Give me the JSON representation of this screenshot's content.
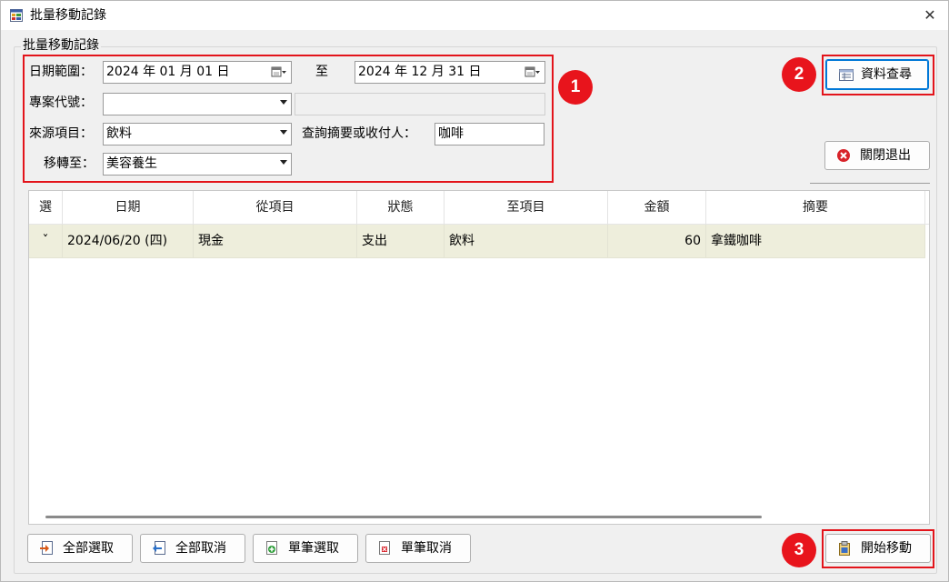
{
  "window": {
    "title": "批量移動記錄",
    "close_glyph": "✕"
  },
  "group": {
    "label": "批量移動記錄"
  },
  "filters": {
    "date_range_label": "日期範圍：",
    "date_from": "2024 年 01 月 01 日",
    "to_label": "至",
    "date_to": "2024 年 12 月 31 日",
    "project_code_label": "專案代號：",
    "project_code_value": "",
    "project_code_extra": "",
    "source_item_label": "來源項目：",
    "source_item_value": "飲料",
    "search_label": "查詢摘要或收付人：",
    "search_value": "咖啡",
    "move_to_label": "移轉至：",
    "move_to_value": "美容養生"
  },
  "buttons": {
    "query": "資料查尋",
    "close_exit": "關閉退出",
    "select_all": "全部選取",
    "cancel_all": "全部取消",
    "select_single": "單筆選取",
    "cancel_single": "單筆取消",
    "start_move": "開始移動"
  },
  "badges": {
    "one": "1",
    "two": "2",
    "three": "3"
  },
  "grid": {
    "columns": [
      "選",
      "日期",
      "從項目",
      "狀態",
      "至項目",
      "金額",
      "摘要"
    ],
    "rows": [
      {
        "select": "ˇ",
        "date": "2024/06/20 (四)",
        "from_item": "現金",
        "status": "支出",
        "to_item": "飲料",
        "amount": "60",
        "summary": "拿鐵咖啡"
      }
    ]
  },
  "colors": {
    "highlight_red": "#e3141b",
    "row_bg": "#eeeedc",
    "focus_blue": "#0078d7"
  },
  "icons": {
    "app": "app-window-icon",
    "calendar": "calendar-dropdown-icon",
    "query": "table-list-icon",
    "close_exit": "red-x-circle-icon",
    "select_all": "select-all-icon",
    "cancel_all": "cancel-all-icon",
    "select_single": "add-doc-icon",
    "cancel_single": "remove-doc-icon",
    "start_move": "clipboard-move-icon"
  }
}
